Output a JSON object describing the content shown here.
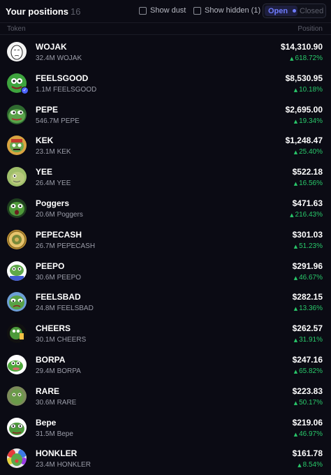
{
  "header": {
    "title": "Your positions",
    "count": "16",
    "show_dust_label": "Show dust",
    "show_hidden_label": "Show hidden (1)",
    "tab_open": "Open",
    "tab_closed": "Closed"
  },
  "columns": {
    "token": "Token",
    "position": "Position"
  },
  "colors": {
    "accent": "#6f7cff",
    "gain": "#29c86a",
    "background": "#0b0b14"
  },
  "positions": [
    {
      "name": "WOJAK",
      "amount": "32.4M WOJAK",
      "value": "$14,310.90",
      "pnl": "618.72%",
      "icon": "wojak-face"
    },
    {
      "name": "FEELSGOOD",
      "amount": "1.1M FEELSGOOD",
      "value": "$8,530.95",
      "pnl": "10.18%",
      "icon": "frog-smile",
      "verified": true
    },
    {
      "name": "PEPE",
      "amount": "546.7M PEPE",
      "value": "$2,695.00",
      "pnl": "19.34%",
      "icon": "pepe-frog"
    },
    {
      "name": "KEK",
      "amount": "23.1M KEK",
      "value": "$1,248.47",
      "pnl": "25.40%",
      "icon": "kek-frog"
    },
    {
      "name": "YEE",
      "amount": "26.4M YEE",
      "value": "$522.18",
      "pnl": "16.56%",
      "icon": "yee-dino"
    },
    {
      "name": "Poggers",
      "amount": "20.6M Poggers",
      "value": "$471.63",
      "pnl": "216.43%",
      "icon": "poggers-frog"
    },
    {
      "name": "PEPECASH",
      "amount": "26.7M PEPECASH",
      "value": "$301.03",
      "pnl": "51.23%",
      "icon": "pepecash-coin"
    },
    {
      "name": "PEEPO",
      "amount": "30.6M PEEPO",
      "value": "$291.96",
      "pnl": "46.67%",
      "icon": "peepo-frog"
    },
    {
      "name": "FEELSBAD",
      "amount": "24.8M FEELSBAD",
      "value": "$282.15",
      "pnl": "13.36%",
      "icon": "feelsbad-frog"
    },
    {
      "name": "CHEERS",
      "amount": "30.1M CHEERS",
      "value": "$262.57",
      "pnl": "31.91%",
      "icon": "cheers-frog"
    },
    {
      "name": "BORPA",
      "amount": "29.4M BORPA",
      "value": "$247.16",
      "pnl": "65.82%",
      "icon": "borpa-frog"
    },
    {
      "name": "RARE",
      "amount": "30.6M RARE",
      "value": "$223.83",
      "pnl": "50.17%",
      "icon": "rare-pepe"
    },
    {
      "name": "Bepe",
      "amount": "31.5M Bepe",
      "value": "$219.06",
      "pnl": "46.97%",
      "icon": "bepe-frog"
    },
    {
      "name": "HONKLER",
      "amount": "23.4M HONKLER",
      "value": "$161.78",
      "pnl": "8.54%",
      "icon": "honkler-clown"
    }
  ]
}
